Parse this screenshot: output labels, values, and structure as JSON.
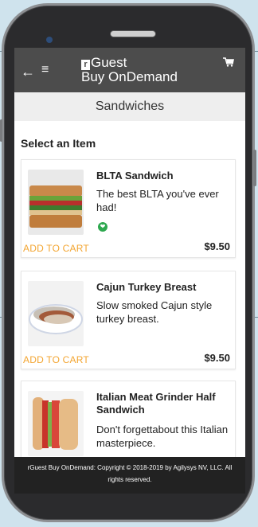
{
  "app": {
    "logo_mark": "r",
    "logo_line1": "Guest",
    "logo_line2": "Buy OnDemand"
  },
  "icons": {
    "back": "arrow-left-icon",
    "menu": "hamburger-menu-icon",
    "cart": "shopping-cart-icon",
    "veg": "vegetarian-leaf-icon"
  },
  "page": {
    "title": "Sandwiches",
    "section_title": "Select an Item"
  },
  "items": [
    {
      "name": "BLTA Sandwich",
      "description": "The best BLTA you've ever had!",
      "add_label": "ADD TO CART",
      "price": "$9.50",
      "tag": "vegetarian"
    },
    {
      "name": "Cajun Turkey Breast",
      "description": "Slow smoked Cajun style turkey breast.",
      "add_label": "ADD TO CART",
      "price": "$9.50"
    },
    {
      "name": "Italian Meat Grinder Half Sandwich",
      "description": "Don't forgettabout this Italian masterpiece."
    }
  ],
  "footer": {
    "copyright": "rGuest Buy OnDemand: Copyright © 2018-2019 by Agilysys NV, LLC. All rights reserved."
  },
  "colors": {
    "topbar": "#4c4c4c",
    "accent": "#f3a531",
    "veg": "#2ea84f",
    "footer": "#222222"
  }
}
